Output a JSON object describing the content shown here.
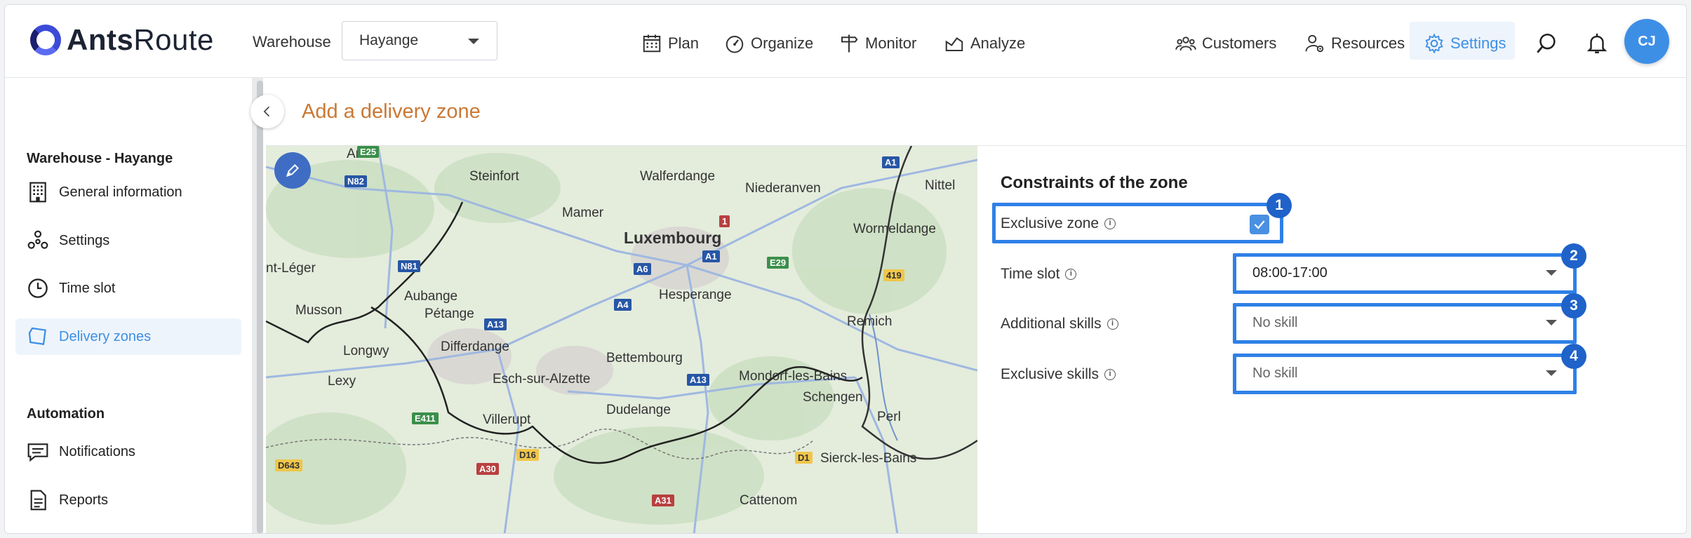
{
  "header": {
    "logo_text_bold": "Ants",
    "logo_text_light": "Route",
    "warehouse_label": "Warehouse",
    "warehouse_value": "Hayange",
    "nav": [
      {
        "label": "Plan",
        "icon": "calendar-icon"
      },
      {
        "label": "Organize",
        "icon": "gauge-icon"
      },
      {
        "label": "Monitor",
        "icon": "signpost-icon"
      },
      {
        "label": "Analyze",
        "icon": "chart-icon"
      }
    ],
    "right_nav": [
      {
        "label": "Customers",
        "icon": "users-icon"
      },
      {
        "label": "Resources",
        "icon": "user-gear-icon"
      },
      {
        "label": "Settings",
        "icon": "gear-icon",
        "active": true
      }
    ],
    "avatar_initials": "CJ"
  },
  "sidebar": {
    "section1_title": "Warehouse - Hayange",
    "items": [
      {
        "label": "General information",
        "icon": "building-icon"
      },
      {
        "label": "Settings",
        "icon": "nodes-icon"
      },
      {
        "label": "Time slot",
        "icon": "clock-icon"
      },
      {
        "label": "Delivery zones",
        "icon": "polygon-icon",
        "active": true
      }
    ],
    "section2_title": "Automation",
    "items2": [
      {
        "label": "Notifications",
        "icon": "message-icon"
      },
      {
        "label": "Reports",
        "icon": "document-icon"
      }
    ]
  },
  "main": {
    "title": "Add a delivery zone",
    "constraints_title": "Constraints of the zone",
    "exclusive_zone_label": "Exclusive zone",
    "exclusive_zone_checked": true,
    "time_slot_label": "Time slot",
    "time_slot_value": "08:00-17:00",
    "additional_skills_label": "Additional skills",
    "additional_skills_value": "No skill",
    "exclusive_skills_label": "Exclusive skills",
    "exclusive_skills_value": "No skill",
    "badges": [
      "1",
      "2",
      "3",
      "4"
    ],
    "accent_color": "#2f80e7"
  },
  "map": {
    "labels": [
      "Arlon",
      "Steinfort",
      "Walferdange",
      "Niederanven",
      "Nittel",
      "Mamer",
      "Luxembourg",
      "Wormeldange",
      "nt-Léger",
      "Aubange",
      "Hesperange",
      "Musson",
      "Pétange",
      "Remich",
      "Longwy",
      "Differdange",
      "Bettembourg",
      "Lexy",
      "Esch-sur-Alzette",
      "Mondorf-les-Bains",
      "Schengen",
      "Perl",
      "Villerupt",
      "Dudelange",
      "Sierck-les-Bains",
      "Cattenom"
    ],
    "roads": [
      "E25",
      "N82",
      "N81",
      "E411",
      "D643",
      "A30",
      "D16",
      "A13",
      "A4",
      "A6",
      "A1",
      "E29",
      "419",
      "D1",
      "A31",
      "1",
      "A13",
      "A1"
    ]
  }
}
